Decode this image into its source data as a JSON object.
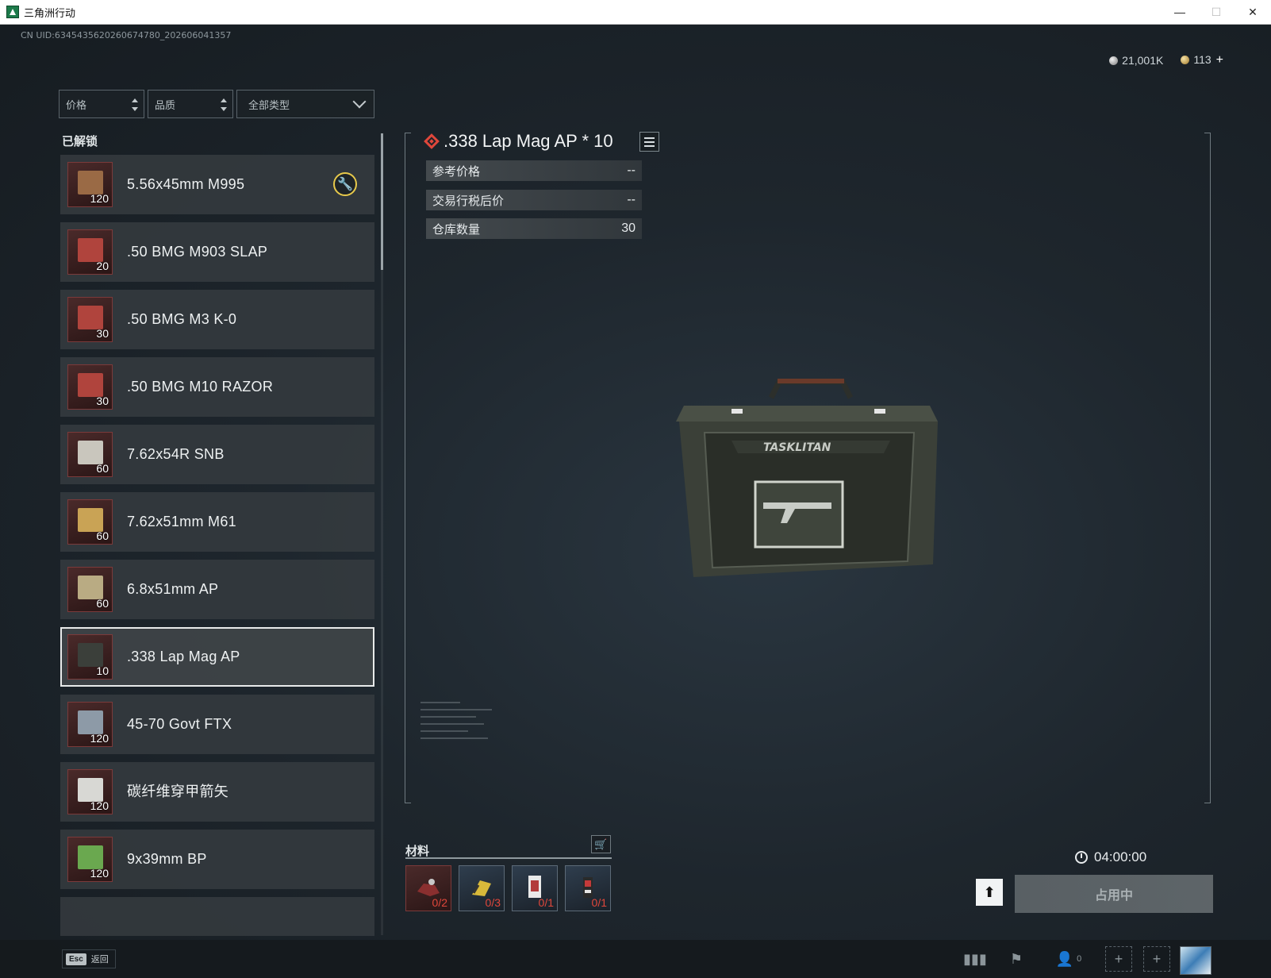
{
  "window": {
    "title": "三角洲行动",
    "minimize": "—",
    "maximize": "☐",
    "close": "✕"
  },
  "header": {
    "uid": "CN UID:6345435620260674780_202606041357",
    "silver": "21,001K",
    "gold": "113",
    "gold_plus": "+"
  },
  "filters": {
    "price": "价格",
    "quality": "品质",
    "type": "全部类型"
  },
  "list": {
    "section_label": "已解锁",
    "items": [
      {
        "name": "5.56x45mm M995",
        "qty": "120",
        "box_color": "#9a6a45"
      },
      {
        "name": ".50 BMG M903 SLAP",
        "qty": "20",
        "box_color": "#b0443d"
      },
      {
        "name": ".50 BMG M3 K-0",
        "qty": "30",
        "box_color": "#b0443d"
      },
      {
        "name": ".50 BMG M10 RAZOR",
        "qty": "30",
        "box_color": "#b0443d"
      },
      {
        "name": "7.62x54R SNB",
        "qty": "60",
        "box_color": "#c9c6bd"
      },
      {
        "name": "7.62x51mm M61",
        "qty": "60",
        "box_color": "#c9a355"
      },
      {
        "name": "6.8x51mm AP",
        "qty": "60",
        "box_color": "#b9ab83"
      },
      {
        "name": ".338 Lap Mag AP",
        "qty": "10",
        "box_color": "#3b3f3a"
      },
      {
        "name": "45-70 Govt FTX",
        "qty": "120",
        "box_color": "#8d9aa7"
      },
      {
        "name": "碳纤维穿甲箭矢",
        "qty": "120",
        "box_color": "#d8d8d4"
      },
      {
        "name": "9x39mm BP",
        "qty": "120",
        "box_color": "#6aa84f"
      }
    ]
  },
  "detail": {
    "title": ".338 Lap Mag AP * 10",
    "stats": [
      {
        "label": "参考价格",
        "value": "--"
      },
      {
        "label": "交易行税后价",
        "value": "--"
      },
      {
        "label": "仓库数量",
        "value": "30"
      }
    ],
    "box_brand": "TASKLITAN"
  },
  "materials": {
    "label": "材料",
    "slots": [
      {
        "qty": "0/2"
      },
      {
        "qty": "0/3"
      },
      {
        "qty": "0/1"
      },
      {
        "qty": "0/1"
      }
    ]
  },
  "craft": {
    "time": "04:00:00",
    "button": "占用中"
  },
  "bottombar": {
    "esc_key": "Esc",
    "esc_label": "返回",
    "friends_count": "0"
  }
}
